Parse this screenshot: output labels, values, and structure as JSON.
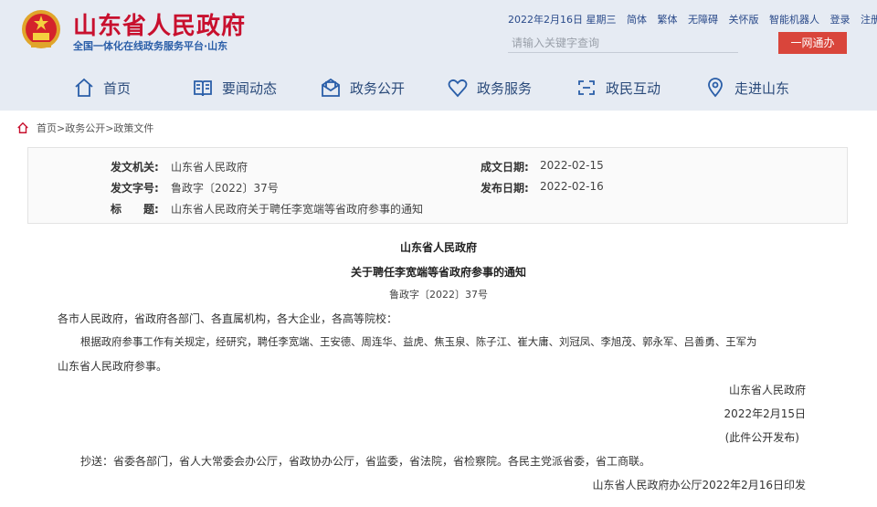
{
  "header": {
    "site_title": "山东省人民政府",
    "site_subtitle": "全国一体化在线政务服务平台·山东",
    "toplinks": [
      "2022年2月16日 星期三",
      "简体",
      "繁体",
      "无障碍",
      "关怀版",
      "智能机器人",
      "登录",
      "注册"
    ],
    "search_placeholder": "请输入关键字查询",
    "login_button": "一网通办"
  },
  "nav": [
    {
      "label": "首页",
      "icon": "home-icon"
    },
    {
      "label": "要闻动态",
      "icon": "news-icon"
    },
    {
      "label": "政务公开",
      "icon": "mail-icon"
    },
    {
      "label": "政务服务",
      "icon": "heart-icon"
    },
    {
      "label": "政民互动",
      "icon": "interact-icon"
    },
    {
      "label": "走进山东",
      "icon": "location-icon"
    }
  ],
  "breadcrumb": "首页>政务公开>政策文件",
  "meta": {
    "issuer_label": "发文机关:",
    "issuer": "山东省人民政府",
    "number_label": "发文字号:",
    "number": "鲁政字〔2022〕37号",
    "title_label": "标　　题:",
    "title": "山东省人民政府关于聘任李宽端等省政府参事的通知",
    "created_label": "成文日期:",
    "created": "2022-02-15",
    "published_label": "发布日期:",
    "published": "2022-02-16"
  },
  "document": {
    "org": "山东省人民政府",
    "title": "关于聘任李宽端等省政府参事的通知",
    "number": "鲁政字〔2022〕37号",
    "salutation": "各市人民政府，省政府各部门、各直属机构，各大企业，各高等院校：",
    "body_line1": "根据政府参事工作有关规定，经研究，聘任李宽端、王安德、周连华、益虎、焦玉泉、陈子江、崔大庸、刘冠凤、李旭茂、郭永军、吕善勇、王军为",
    "body_line2": "山东省人民政府参事。",
    "sign_org": "山东省人民政府",
    "sign_date": "2022年2月15日",
    "public_note": "(此件公开发布)",
    "cc": "抄送：省委各部门，省人大常委会办公厅，省政协办公厅，省监委，省法院，省检察院。各民主党派省委，省工商联。",
    "footer": "山东省人民政府办公厅2022年2月16日印发"
  }
}
